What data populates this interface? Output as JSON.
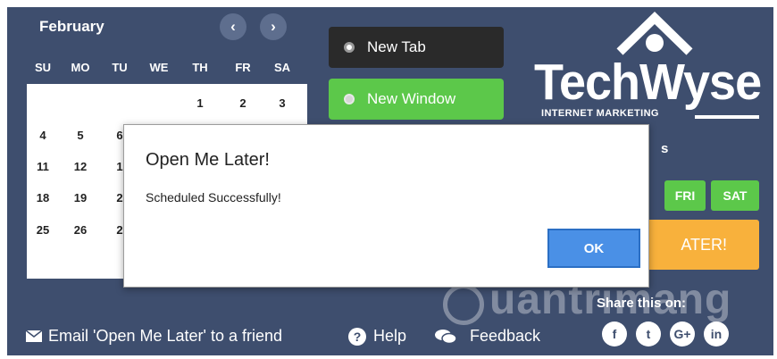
{
  "calendar": {
    "month": "February",
    "prev_icon": "‹",
    "next_icon": "›",
    "day_names": [
      "SU",
      "MO",
      "TU",
      "WE",
      "TH",
      "FR",
      "SA"
    ],
    "row1": [
      "1",
      "2",
      "3"
    ],
    "row2": [
      "4",
      "5",
      "6"
    ],
    "row3": [
      "11",
      "12",
      "1"
    ],
    "row4": [
      "18",
      "19",
      "2"
    ],
    "row5": [
      "25",
      "26",
      "2"
    ]
  },
  "open_mode": {
    "new_tab": "New Tab",
    "new_window": "New Window"
  },
  "logo": {
    "word": "TechWyse",
    "subtitle": "INTERNET MARKETING"
  },
  "partial_label": "s",
  "days": {
    "fri": "FRI",
    "sat": "SAT"
  },
  "later_button": "ATER!",
  "footer": {
    "email": "Email 'Open Me Later' to a friend",
    "help": "Help",
    "feedback": "Feedback",
    "share": "Share this on:"
  },
  "social": {
    "facebook": "f",
    "twitter": "t",
    "googleplus": "G+",
    "linkedin": "in"
  },
  "watermark": "uantrimang",
  "dialog": {
    "title": "Open Me Later!",
    "message": "Scheduled Successfully!",
    "ok": "OK"
  },
  "colors": {
    "panel": "#3e4e6e",
    "green": "#5cc84a",
    "orange": "#f8b13c",
    "ok_blue": "#4a90e6"
  }
}
